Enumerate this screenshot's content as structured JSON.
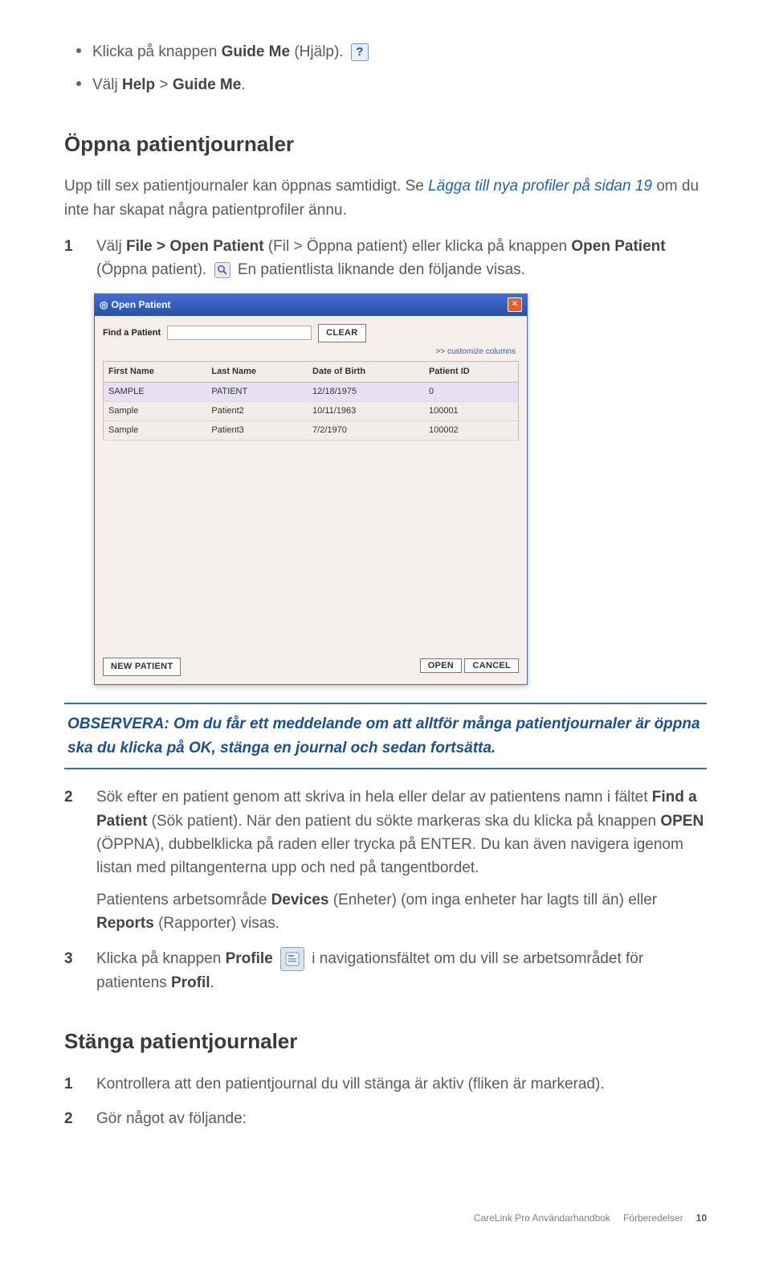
{
  "intro_bullets": [
    {
      "pre": "Klicka på knappen ",
      "bold": "Guide Me",
      "post": " (Hjälp)."
    },
    {
      "pre": "Välj ",
      "bold": "Help",
      "mid": " > ",
      "bold2": "Guide Me",
      "post": "."
    }
  ],
  "section1": {
    "heading": "Öppna patientjournaler",
    "p1": "Upp till sex patientjournaler kan öppnas samtidigt. Se ",
    "p1_link": "Lägga till nya profiler på sidan 19",
    "p1_tail": " om du inte har skapat några patientprofiler ännu.",
    "step1": {
      "num": "1",
      "pre": "Välj ",
      "b1": "File > Open Patient",
      "mid": " (Fil > Öppna patient) eller klicka på knappen ",
      "b2": "Open Patient",
      "tail1": " (Öppna patient). ",
      "tail2": " En patientlista liknande den följande visas."
    },
    "dialog": {
      "title": "Open Patient",
      "find_label": "Find a Patient",
      "clear_btn": "CLEAR",
      "customize": ">> customize columns",
      "cols": [
        "First Name",
        "Last Name",
        "Date of Birth",
        "Patient ID"
      ],
      "rows": [
        {
          "fn": "SAMPLE",
          "ln": "PATIENT",
          "dob": "12/18/1975",
          "id": "0",
          "sel": true
        },
        {
          "fn": "Sample",
          "ln": "Patient2",
          "dob": "10/11/1963",
          "id": "100001",
          "sel": false
        },
        {
          "fn": "Sample",
          "ln": "Patient3",
          "dob": "7/2/1970",
          "id": "100002",
          "sel": false
        }
      ],
      "new_btn": "NEW PATIENT",
      "open_btn": "OPEN",
      "cancel_btn": "CANCEL"
    },
    "note": "OBSERVERA: Om du får ett meddelande om att alltför många patientjournaler är öppna ska du klicka på OK, stänga en journal och sedan fortsätta.",
    "step2": {
      "num": "2",
      "t1": "Sök efter en patient genom att skriva in hela eller delar av patientens namn i fältet ",
      "b1": "Find a Patient",
      "t2": " (Sök patient). När den patient du sökte markeras ska du klicka på knappen ",
      "b2": "OPEN",
      "t3": " (ÖPPNA), dubbelklicka på raden eller trycka på ENTER. Du kan även navigera igenom listan med piltangenterna upp och ned på tangentbordet.",
      "p2a": "Patientens arbetsområde ",
      "p2b": "Devices",
      "p2c": " (Enheter) (om inga enheter har lagts till än) eller ",
      "p2d": "Reports",
      "p2e": " (Rapporter) visas."
    },
    "step3": {
      "num": "3",
      "t1": "Klicka på knappen ",
      "b1": "Profile",
      "t2": " i navigationsfältet om du vill se arbetsområdet för patientens ",
      "b2": "Profil",
      "t3": "."
    }
  },
  "section2": {
    "heading": "Stänga patientjournaler",
    "step1": {
      "num": "1",
      "text": "Kontrollera att den patientjournal du vill stänga är aktiv (fliken är markerad)."
    },
    "step2": {
      "num": "2",
      "text": "Gör något av följande:"
    }
  },
  "footer": {
    "doc": "CareLink Pro Användarhandbok",
    "chapter": "Förberedelser",
    "page": "10"
  }
}
